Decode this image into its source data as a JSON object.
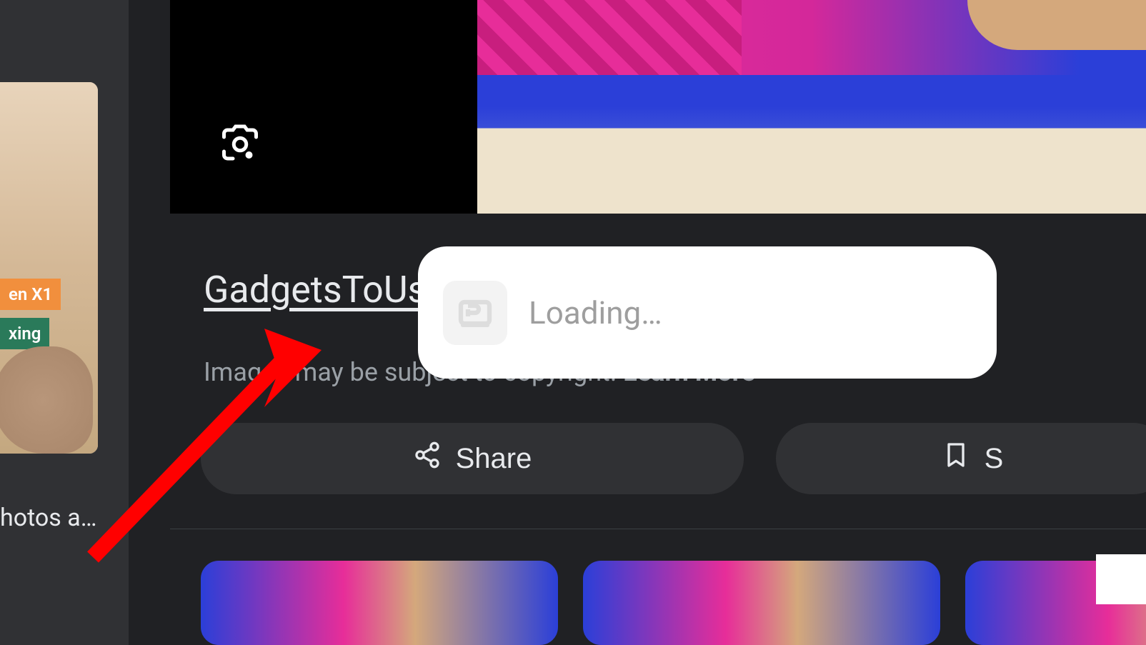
{
  "thumbnail": {
    "badge_orange": "en X1",
    "badge_teal": "xing",
    "caption": "hotos a…"
  },
  "source": {
    "name": "GadgetsToUs"
  },
  "copyright": {
    "text": "Images may be subject to copyright. ",
    "learn_more": "Learn More"
  },
  "actions": {
    "share": "Share",
    "save": "S"
  },
  "popup": {
    "loading_text": "Loading…"
  }
}
